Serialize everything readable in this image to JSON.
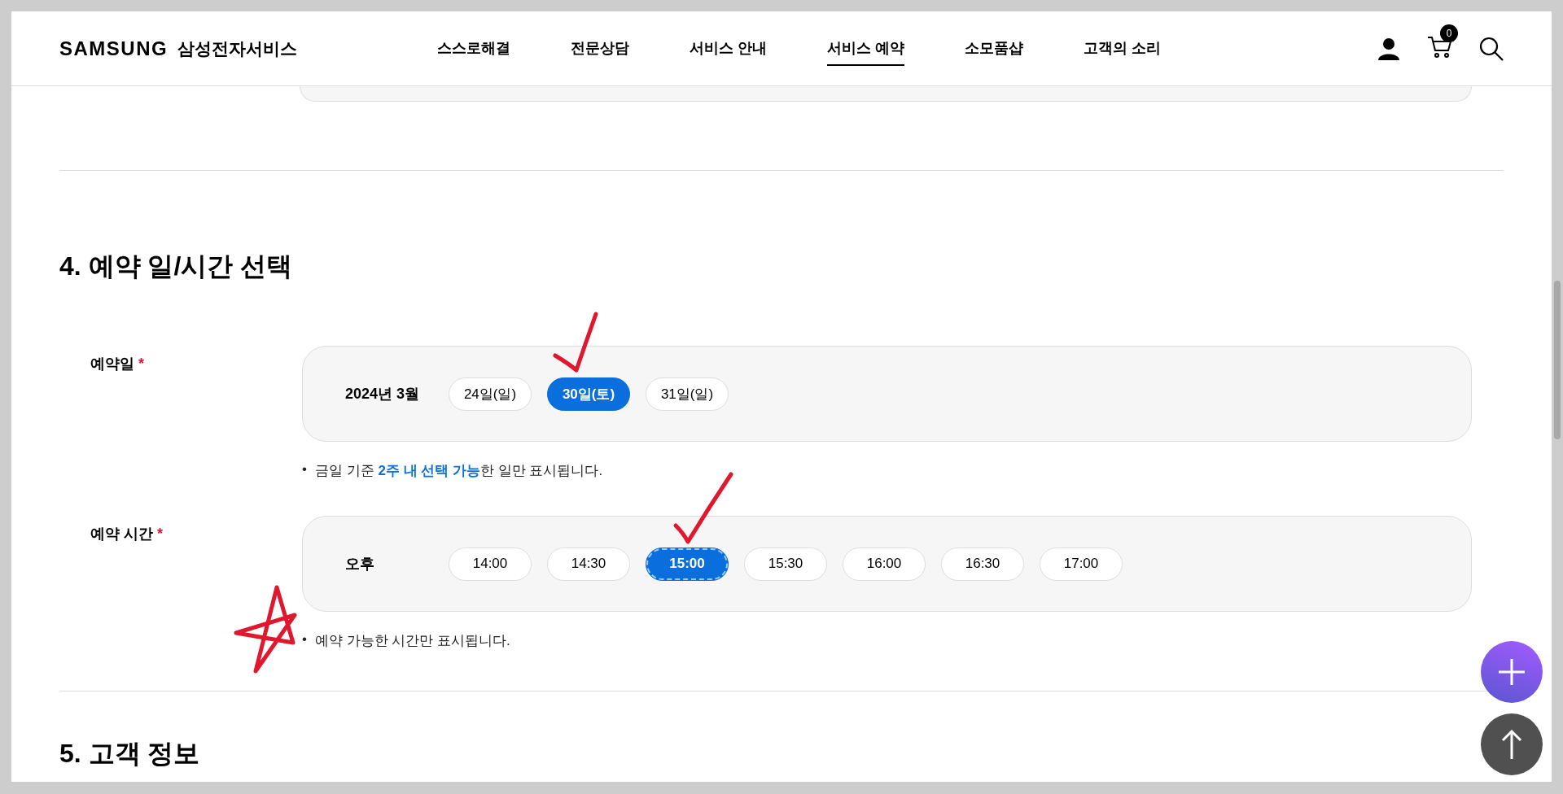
{
  "header": {
    "logo": "SAMSUNG",
    "brand": "삼성전자서비스",
    "nav": [
      {
        "label": "스스로해결",
        "selected": false
      },
      {
        "label": "전문상담",
        "selected": false
      },
      {
        "label": "서비스 안내",
        "selected": false
      },
      {
        "label": "서비스 예약",
        "selected": true
      },
      {
        "label": "소모품샵",
        "selected": false
      },
      {
        "label": "고객의 소리",
        "selected": false
      }
    ],
    "cart_count": "0"
  },
  "section": {
    "title": "4. 예약 일/시간 선택",
    "fields": [
      {
        "label": "예약일",
        "required_mark": "*",
        "group_label": "2024년 3월",
        "options": [
          {
            "label": "24일(일)",
            "selected": false,
            "focused": false
          },
          {
            "label": "30일(토)",
            "selected": true,
            "focused": false
          },
          {
            "label": "31일(일)",
            "selected": false,
            "focused": false
          }
        ],
        "bullet": "•",
        "note": "금일 기준 **2주 내 선택 가능**한 일만 표시됩니다."
      },
      {
        "label": "예약 시간",
        "required_mark": "*",
        "group_label": "오후",
        "options": [
          {
            "label": "14:00",
            "selected": false,
            "focused": false
          },
          {
            "label": "14:30",
            "selected": false,
            "focused": false
          },
          {
            "label": "15:00",
            "selected": true,
            "focused": true
          },
          {
            "label": "15:30",
            "selected": false,
            "focused": false
          },
          {
            "label": "16:00",
            "selected": false,
            "focused": false
          },
          {
            "label": "16:30",
            "selected": false,
            "focused": false
          },
          {
            "label": "17:00",
            "selected": false,
            "focused": false
          }
        ],
        "bullet": "•",
        "note": "예약 가능한 시간만 표시됩니다."
      }
    ]
  },
  "next_section_title": "5. 고객 정보"
}
